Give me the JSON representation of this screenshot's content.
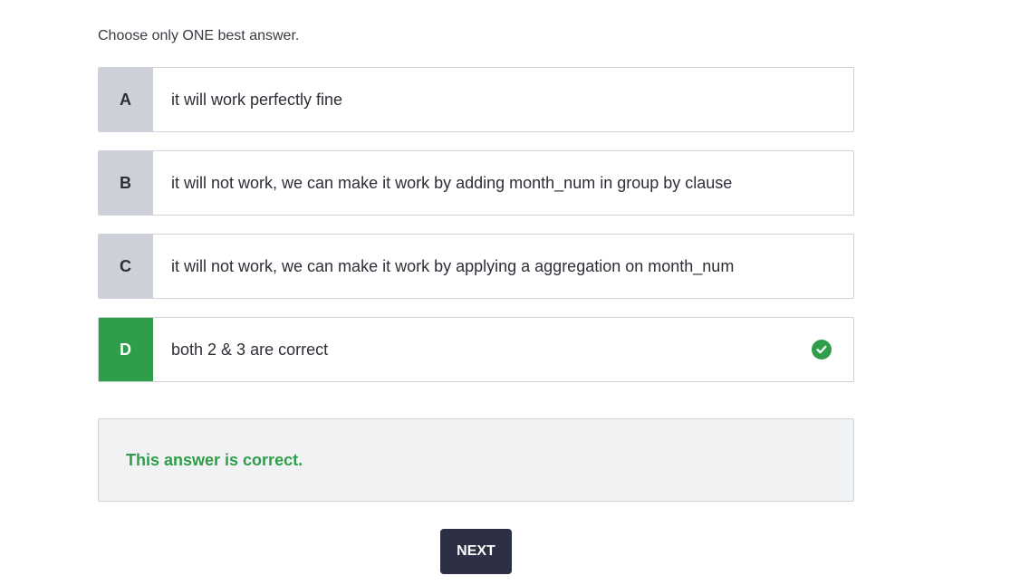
{
  "question": {
    "instruction": "Choose only ONE best answer."
  },
  "options": [
    {
      "letter": "A",
      "text": "it will work perfectly fine",
      "selected": false
    },
    {
      "letter": "B",
      "text": "it will not work, we can make it work by adding month_num in group by clause",
      "selected": false
    },
    {
      "letter": "C",
      "text": "it will not work, we can make it work by applying a aggregation on month_num",
      "selected": false
    },
    {
      "letter": "D",
      "text": "both 2 & 3 are correct",
      "selected": true,
      "status_icon": "check-circle-icon"
    }
  ],
  "feedback": {
    "message": "This answer is correct."
  },
  "actions": {
    "next_label": "NEXT"
  },
  "colors": {
    "correct": "#2f9e4a",
    "letter_bg": "#cdd0d9",
    "button_bg": "#2d2f45"
  }
}
